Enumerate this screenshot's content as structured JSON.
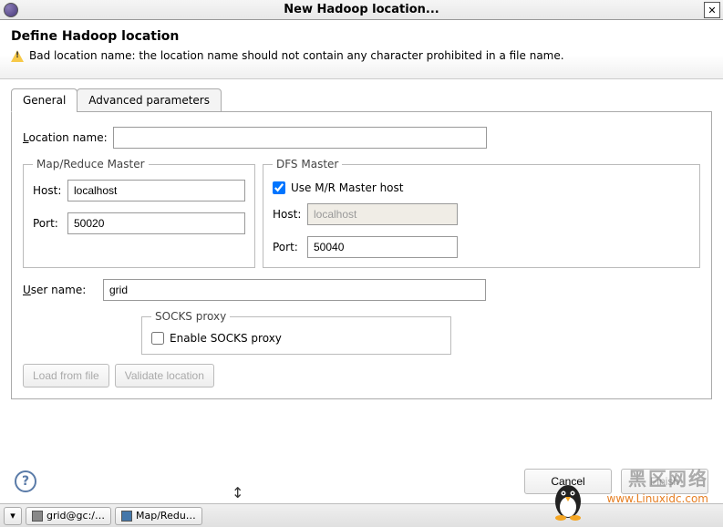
{
  "window": {
    "title": "New Hadoop location..."
  },
  "header": {
    "title": "Define Hadoop location",
    "warning": "Bad location name: the location name should not contain any character prohibited in a file name."
  },
  "tabs": {
    "general": "General",
    "advanced": "Advanced parameters"
  },
  "general": {
    "location_label": "Location name:",
    "location_value": "",
    "mr_legend": "Map/Reduce Master",
    "mr_host_label": "Host:",
    "mr_host_value": "localhost",
    "mr_port_label": "Port:",
    "mr_port_value": "50020",
    "dfs_legend": "DFS Master",
    "dfs_use_mr_label": "Use M/R Master host",
    "dfs_host_label": "Host:",
    "dfs_host_value": "localhost",
    "dfs_port_label": "Port:",
    "dfs_port_value": "50040",
    "user_label": "User name:",
    "user_value": "grid",
    "socks_legend": "SOCKS proxy",
    "socks_enable_label": "Enable SOCKS proxy",
    "load_btn": "Load from file",
    "validate_btn": "Validate location"
  },
  "footer": {
    "cancel": "Cancel",
    "finish": "Finish"
  },
  "taskbar": {
    "item1": "grid@gc:/…",
    "item2": "Map/Redu…"
  },
  "watermark": {
    "text1": "黑区网络",
    "text2": "www.Linuxidc.com"
  }
}
